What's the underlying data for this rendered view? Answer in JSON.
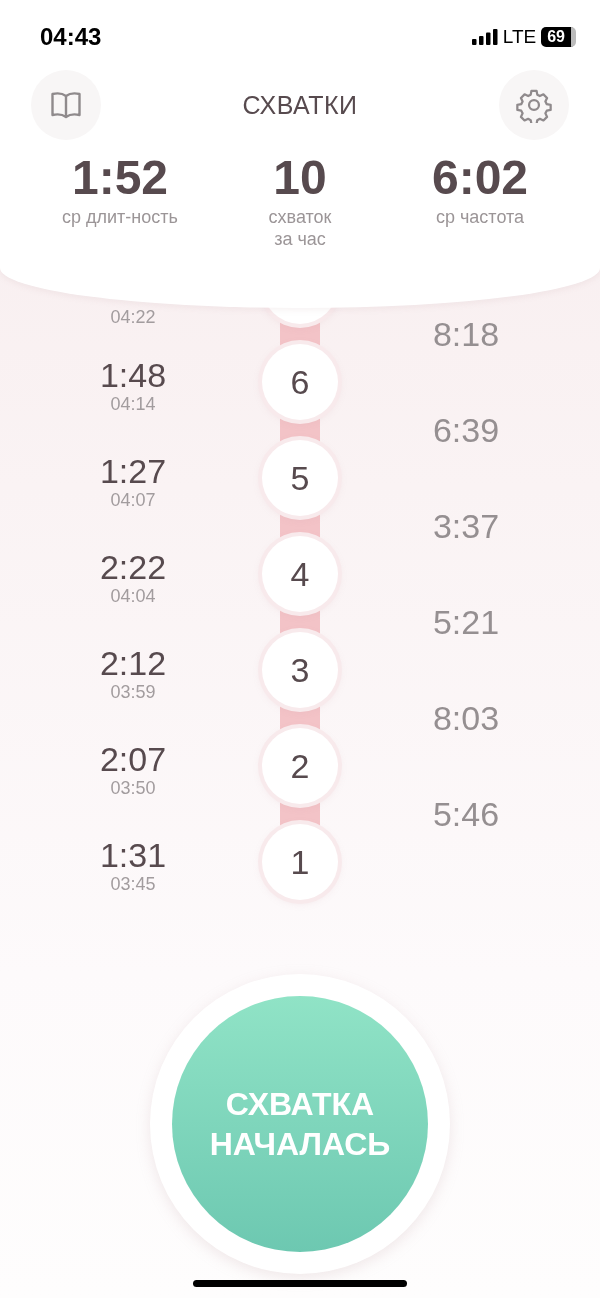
{
  "status_bar": {
    "time": "04:43",
    "network": "LTE",
    "battery": "69"
  },
  "header": {
    "title": "СХВАТКИ"
  },
  "stats": [
    {
      "value": "1:52",
      "label_lines": [
        "ср длит-ность"
      ]
    },
    {
      "value": "10",
      "label_lines": [
        "схваток",
        "за час"
      ]
    },
    {
      "value": "6:02",
      "label_lines": [
        "ср частота"
      ]
    }
  ],
  "contractions": [
    {
      "start": "04:22"
    },
    {
      "number": "6",
      "duration": "1:48",
      "start": "04:14"
    },
    {
      "number": "5",
      "duration": "1:27",
      "start": "04:07"
    },
    {
      "number": "4",
      "duration": "2:22",
      "start": "04:04"
    },
    {
      "number": "3",
      "duration": "2:12",
      "start": "03:59"
    },
    {
      "number": "2",
      "duration": "2:07",
      "start": "03:50"
    },
    {
      "number": "1",
      "duration": "1:31",
      "start": "03:45"
    }
  ],
  "intervals": [
    "8:18",
    "6:39",
    "3:37",
    "5:21",
    "8:03",
    "5:46"
  ],
  "start_button": {
    "label": "СХВАТКА НАЧАЛАСЬ"
  }
}
